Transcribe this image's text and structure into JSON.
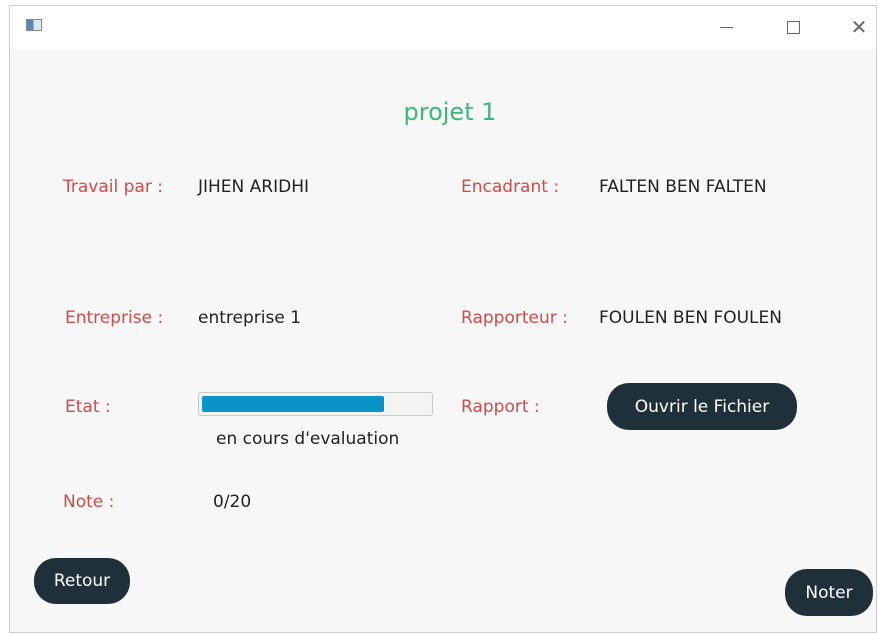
{
  "window": {
    "controls": {
      "minimize": "minimize-icon",
      "maximize": "maximize-icon",
      "close": "close-icon"
    }
  },
  "title": "projet 1",
  "fields": {
    "travail_par": {
      "label": "Travail par :",
      "value": "JIHEN ARIDHI"
    },
    "encadrant": {
      "label": "Encadrant :",
      "value": "FALTEN BEN FALTEN"
    },
    "entreprise": {
      "label": "Entreprise :",
      "value": "entreprise 1"
    },
    "rapporteur": {
      "label": "Rapporteur :",
      "value": "FOULEN BEN FOULEN"
    },
    "etat": {
      "label": "Etat :",
      "progress": 0.8,
      "status": "en cours d'evaluation"
    },
    "rapport": {
      "label": "Rapport :",
      "button": "Ouvrir le Fichier"
    },
    "note": {
      "label": "Note :",
      "value": "0/20"
    }
  },
  "buttons": {
    "back": "Retour",
    "grade": "Noter"
  },
  "colors": {
    "title": "#3cb878",
    "label": "#d14b4b",
    "progress": "#0a93c7",
    "button": "#20303b"
  }
}
